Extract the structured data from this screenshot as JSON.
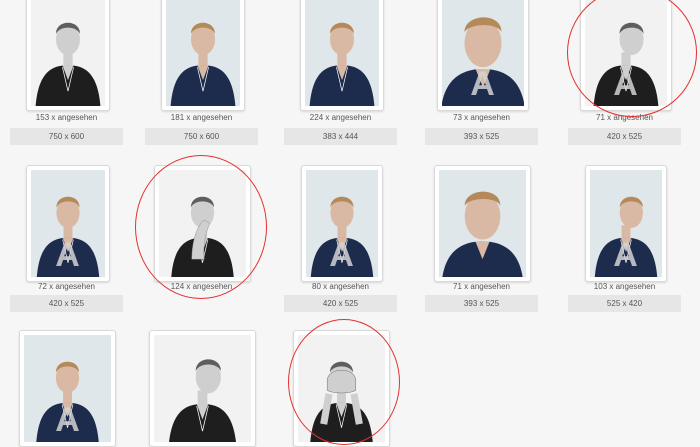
{
  "gallery": {
    "items": [
      {
        "views": "153 x angesehen",
        "size": "750 x 600",
        "tone": "bw",
        "watermark": false,
        "pose": "front"
      },
      {
        "views": "181 x angesehen",
        "size": "750 x 600",
        "tone": "color",
        "watermark": false,
        "pose": "front"
      },
      {
        "views": "224 x angesehen",
        "size": "383 x 444",
        "tone": "color",
        "watermark": false,
        "pose": "front"
      },
      {
        "views": "73 x angesehen",
        "size": "393 x 525",
        "tone": "color",
        "watermark": true,
        "pose": "close"
      },
      {
        "views": "71 x angesehen",
        "size": "420 x 525",
        "tone": "bw",
        "watermark": true,
        "pose": "side"
      },
      {
        "views": "72 x angesehen",
        "size": "420 x 525",
        "tone": "color",
        "watermark": true,
        "pose": "front"
      },
      {
        "views": "124 x angesehen",
        "size": "",
        "tone": "bw",
        "watermark": false,
        "pose": "hand"
      },
      {
        "views": "80 x angesehen",
        "size": "420 x 525",
        "tone": "color",
        "watermark": true,
        "pose": "front"
      },
      {
        "views": "71 x angesehen",
        "size": "393 x 525",
        "tone": "color",
        "watermark": false,
        "pose": "close"
      },
      {
        "views": "103 x angesehen",
        "size": "525 x 420",
        "tone": "color",
        "watermark": true,
        "pose": "side"
      },
      {
        "views": "",
        "size": "",
        "tone": "color",
        "watermark": true,
        "pose": "front"
      },
      {
        "views": "",
        "size": "",
        "tone": "bw",
        "watermark": false,
        "pose": "side"
      },
      {
        "views": "",
        "size": "",
        "tone": "bw",
        "watermark": false,
        "pose": "hands-face"
      }
    ]
  },
  "watermark_glyph": "A",
  "colors": {
    "annotation_circle": "#e53030",
    "shirt_color": "#1d2b4d",
    "shirt_bw": "#1e1e1e",
    "skin": "#d9b9a3",
    "hair": "#b58a5a"
  }
}
